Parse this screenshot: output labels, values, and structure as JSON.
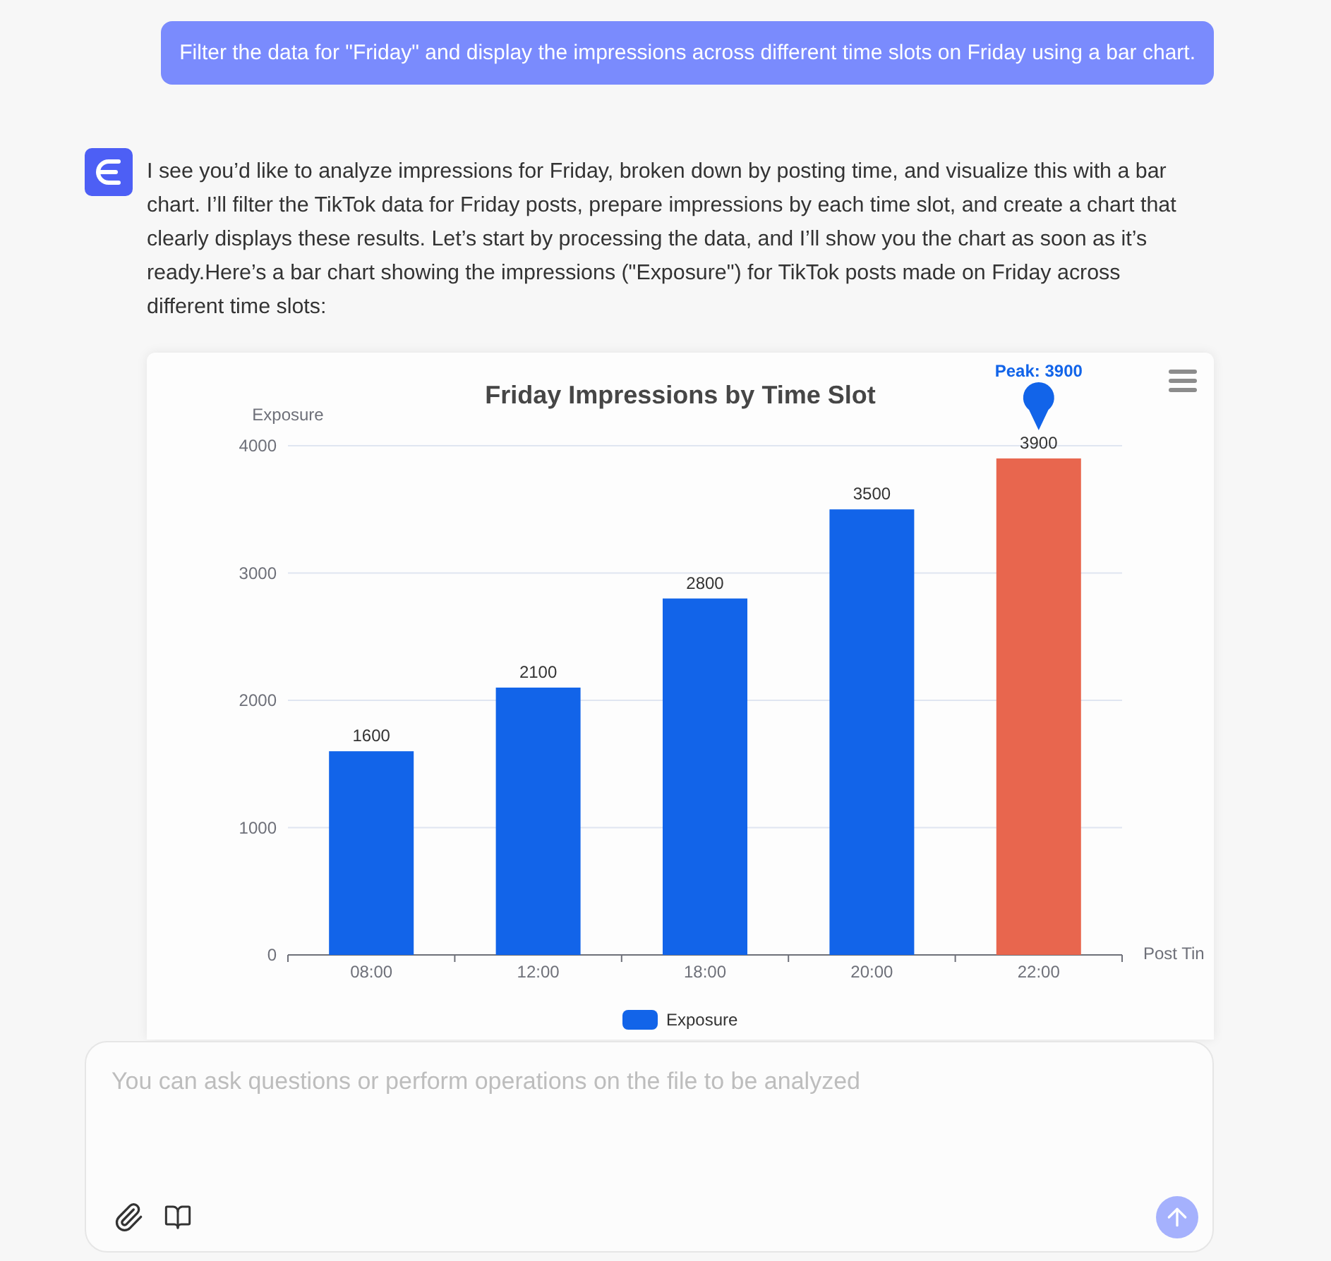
{
  "user_message": {
    "text": "Filter the data for \"Friday\" and display the impressions across different time slots on Friday using a bar chart."
  },
  "assistant_message": {
    "text": "I see you’d like to analyze impressions for Friday, broken down by posting time, and visualize this with a bar chart. I’ll filter the TikTok data for Friday posts, prepare impressions by each time slot, and create a chart that clearly displays these results. Let’s start by processing the data, and I’ll show you the chart as soon as it’s ready.Here’s a bar chart showing the impressions (\"Exposure\") for TikTok posts made on Friday across different time slots:"
  },
  "chart": {
    "chart_data": {
      "type": "bar",
      "title": "Friday Impressions by Time Slot",
      "xlabel": "Post Tin",
      "ylabel": "Exposure",
      "categories": [
        "08:00",
        "12:00",
        "18:00",
        "20:00",
        "22:00"
      ],
      "series": [
        {
          "name": "Exposure",
          "color": "#1264e9",
          "values": [
            1600,
            2100,
            2800,
            3500,
            3900
          ],
          "colors": [
            "#1264e9",
            "#1264e9",
            "#1264e9",
            "#1264e9",
            "#e8664e"
          ]
        }
      ],
      "ylim": [
        0,
        4000
      ],
      "yticks": [
        0,
        1000,
        2000,
        3000,
        4000
      ],
      "grid": true,
      "data_labels": true,
      "annotations": [
        "Peak: 3900"
      ]
    }
  },
  "composer": {
    "placeholder": "You can ask questions or perform operations on the file to be analyzed"
  }
}
